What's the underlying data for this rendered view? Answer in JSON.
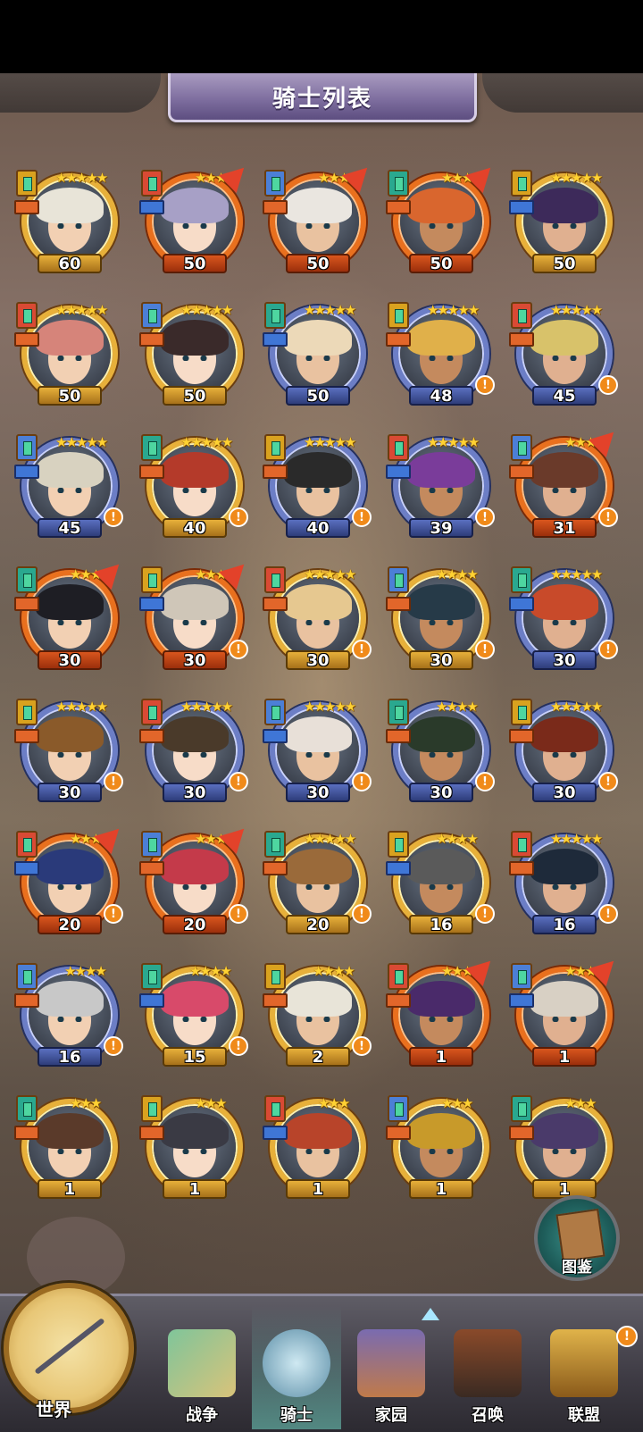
{
  "header": {
    "title": "骑士列表"
  },
  "colors": {
    "gold": "#e7b03a",
    "orange": "#e9701e",
    "blue": "#6c7ec6",
    "alert": "#f08a1a"
  },
  "knights": [
    {
      "level": "60",
      "rarity": "gold",
      "stars": 5,
      "alert": false
    },
    {
      "level": "50",
      "rarity": "orange",
      "stars": 3,
      "alert": false
    },
    {
      "level": "50",
      "rarity": "orange",
      "stars": 3,
      "alert": false
    },
    {
      "level": "50",
      "rarity": "orange",
      "stars": 3,
      "alert": false
    },
    {
      "level": "50",
      "rarity": "gold",
      "stars": 5,
      "alert": false
    },
    {
      "level": "50",
      "rarity": "gold",
      "stars": 5,
      "alert": false
    },
    {
      "level": "50",
      "rarity": "gold",
      "stars": 5,
      "alert": false
    },
    {
      "level": "50",
      "rarity": "blue",
      "stars": 5,
      "alert": false
    },
    {
      "level": "48",
      "rarity": "blue",
      "stars": 5,
      "alert": true
    },
    {
      "level": "45",
      "rarity": "blue",
      "stars": 5,
      "alert": true
    },
    {
      "level": "45",
      "rarity": "blue",
      "stars": 5,
      "alert": true
    },
    {
      "level": "40",
      "rarity": "gold",
      "stars": 5,
      "alert": true
    },
    {
      "level": "40",
      "rarity": "blue",
      "stars": 5,
      "alert": true
    },
    {
      "level": "39",
      "rarity": "blue",
      "stars": 5,
      "alert": true
    },
    {
      "level": "31",
      "rarity": "orange",
      "stars": 3,
      "alert": true
    },
    {
      "level": "30",
      "rarity": "orange",
      "stars": 3,
      "alert": false
    },
    {
      "level": "30",
      "rarity": "orange",
      "stars": 3,
      "alert": true
    },
    {
      "level": "30",
      "rarity": "gold",
      "stars": 5,
      "alert": true
    },
    {
      "level": "30",
      "rarity": "gold",
      "stars": 4,
      "alert": true
    },
    {
      "level": "30",
      "rarity": "blue",
      "stars": 5,
      "alert": true
    },
    {
      "level": "30",
      "rarity": "blue",
      "stars": 5,
      "alert": true
    },
    {
      "level": "30",
      "rarity": "blue",
      "stars": 5,
      "alert": true
    },
    {
      "level": "30",
      "rarity": "blue",
      "stars": 5,
      "alert": true
    },
    {
      "level": "30",
      "rarity": "blue",
      "stars": 4,
      "alert": true
    },
    {
      "level": "30",
      "rarity": "blue",
      "stars": 5,
      "alert": true
    },
    {
      "level": "20",
      "rarity": "orange",
      "stars": 3,
      "alert": true
    },
    {
      "level": "20",
      "rarity": "orange",
      "stars": 3,
      "alert": true
    },
    {
      "level": "20",
      "rarity": "gold",
      "stars": 5,
      "alert": true
    },
    {
      "level": "16",
      "rarity": "gold",
      "stars": 4,
      "alert": true
    },
    {
      "level": "16",
      "rarity": "blue",
      "stars": 5,
      "alert": true
    },
    {
      "level": "16",
      "rarity": "blue",
      "stars": 4,
      "alert": true
    },
    {
      "level": "15",
      "rarity": "gold",
      "stars": 4,
      "alert": true
    },
    {
      "level": "2",
      "rarity": "gold",
      "stars": 4,
      "alert": true
    },
    {
      "level": "1",
      "rarity": "orange",
      "stars": 3,
      "alert": false
    },
    {
      "level": "1",
      "rarity": "orange",
      "stars": 3,
      "alert": false
    },
    {
      "level": "1",
      "rarity": "gold",
      "stars": 3,
      "alert": false
    },
    {
      "level": "1",
      "rarity": "gold",
      "stars": 3,
      "alert": false
    },
    {
      "level": "1",
      "rarity": "gold",
      "stars": 3,
      "alert": false
    },
    {
      "level": "1",
      "rarity": "gold",
      "stars": 3,
      "alert": false
    },
    {
      "level": "1",
      "rarity": "gold",
      "stars": 3,
      "alert": false
    }
  ],
  "codex": {
    "label": "图鉴",
    "icon": "book-icon"
  },
  "nav": {
    "world": "世界",
    "items": [
      {
        "label": "战争",
        "icon": "map-icon",
        "active": false
      },
      {
        "label": "骑士",
        "icon": "knight-icon",
        "active": true
      },
      {
        "label": "家园",
        "icon": "house-icon",
        "active": false
      },
      {
        "label": "召唤",
        "icon": "train-icon",
        "active": false
      },
      {
        "label": "联盟",
        "icon": "chest-icon",
        "active": false
      }
    ],
    "alliance_alert": "!"
  }
}
